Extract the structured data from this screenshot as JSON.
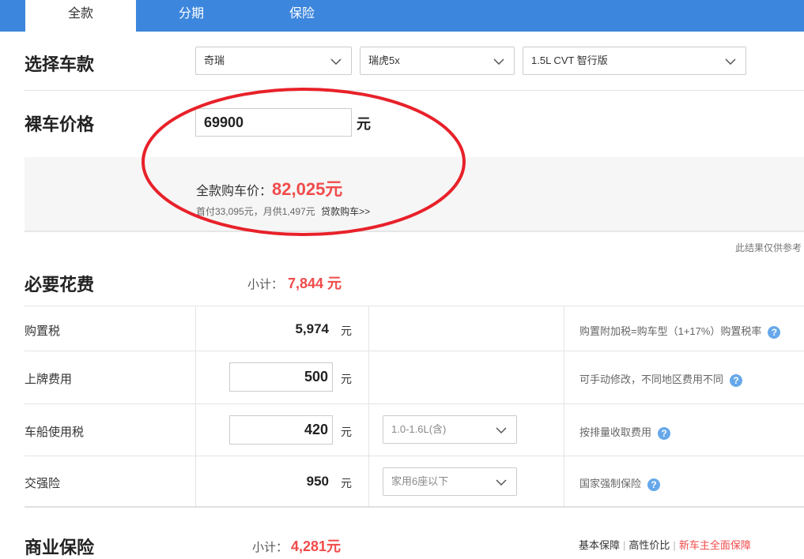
{
  "tabs": [
    "全款",
    "分期",
    "保险"
  ],
  "select_car": {
    "title": "选择车款",
    "brand": "奇瑞",
    "series": "瑞虎5x",
    "model": "1.5L CVT 智行版"
  },
  "bare_price": {
    "title": "裸车价格",
    "value": "69900",
    "unit": "元"
  },
  "result": {
    "label": "全款购车价：",
    "amount": "82,025元",
    "sub": "首付33,095元，月供1,497元",
    "loan_link": "贷款购车>>",
    "disclaimer": "此结果仅供参考"
  },
  "necessary": {
    "title": "必要花费",
    "subtotal_label": "小计：",
    "subtotal": "7,844 元",
    "rows": [
      {
        "label": "购置税",
        "value": "5,974",
        "unit": "元",
        "note": "购置附加税=购车型（1+17%）购置税率"
      },
      {
        "label": "上牌费用",
        "value": "500",
        "unit": "元",
        "note": "可手动修改，不同地区费用不同"
      },
      {
        "label": "车船使用税",
        "value": "420",
        "unit": "元",
        "option": "1.0-1.6L(含)",
        "note": "按排量收取费用"
      },
      {
        "label": "交强险",
        "value": "950",
        "unit": "元",
        "option": "家用6座以下",
        "note": "国家强制保险"
      }
    ]
  },
  "commercial": {
    "title": "商业保险",
    "subtotal_label": "小计：",
    "subtotal": "4,281元",
    "links": [
      "基本保障",
      "高性价比",
      "新车主全面保障"
    ]
  },
  "help_glyph": "?",
  "colors": {
    "tab_bar": "#3d86dd",
    "accent_red": "#f04b4b",
    "ellipse": "#e8212a",
    "help": "#66a8ea"
  }
}
